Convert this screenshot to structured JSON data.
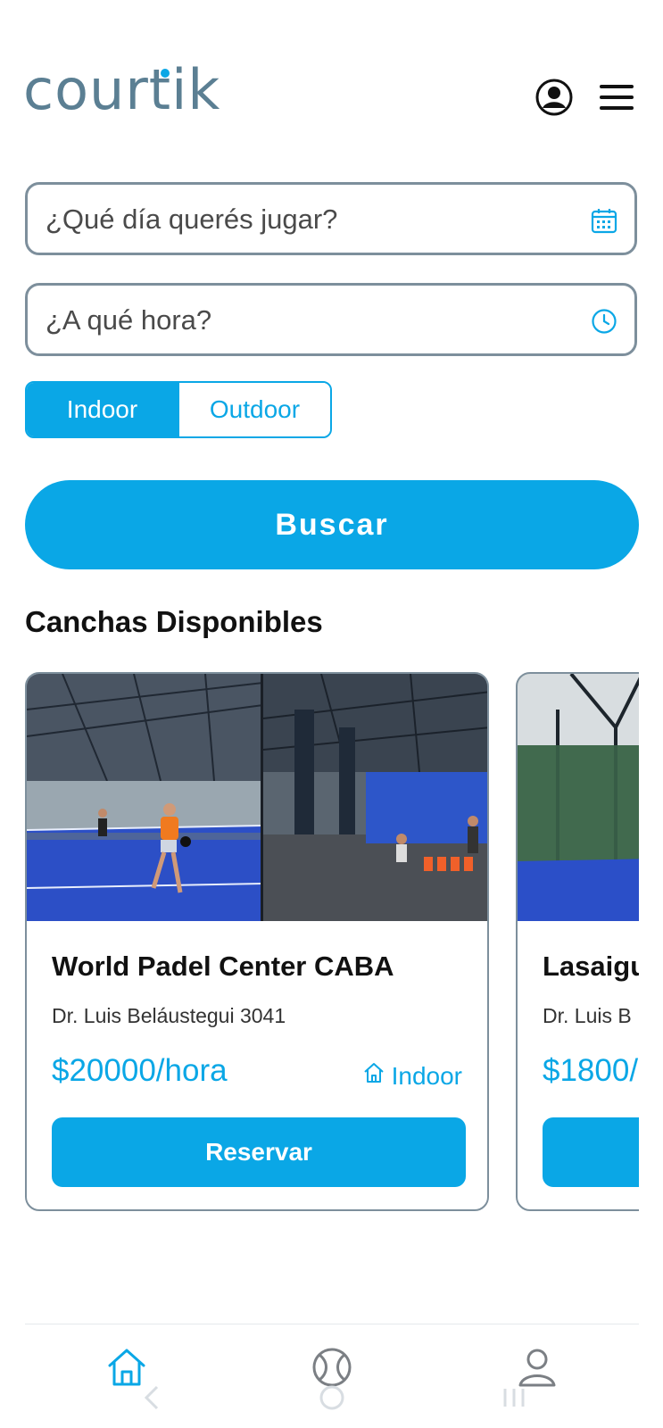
{
  "header": {
    "logo_text": "courtik"
  },
  "search": {
    "date_placeholder": "¿Qué día querés jugar?",
    "time_placeholder": "¿A qué hora?",
    "toggle": {
      "selected": "Indoor",
      "options": [
        "Indoor",
        "Outdoor"
      ]
    },
    "button_label": "Buscar"
  },
  "section": {
    "title": "Canchas Disponibles"
  },
  "courts": [
    {
      "name": "World Padel Center CABA",
      "address": "Dr. Luis Beláustegui 3041",
      "price": "$20000/hora",
      "type": "Indoor",
      "button_label": "Reservar"
    },
    {
      "name": "Lasaigu",
      "address": "Dr. Luis B",
      "price": "$1800/",
      "button_label": ""
    }
  ],
  "bottom_nav": {
    "items": [
      {
        "icon": "home-icon",
        "active": true
      },
      {
        "icon": "tennis-ball-icon",
        "active": false
      },
      {
        "icon": "profile-icon",
        "active": false
      }
    ]
  },
  "colors": {
    "accent": "#0aa7e6",
    "logo": "#5b7f93",
    "border": "#7d8f9c"
  }
}
